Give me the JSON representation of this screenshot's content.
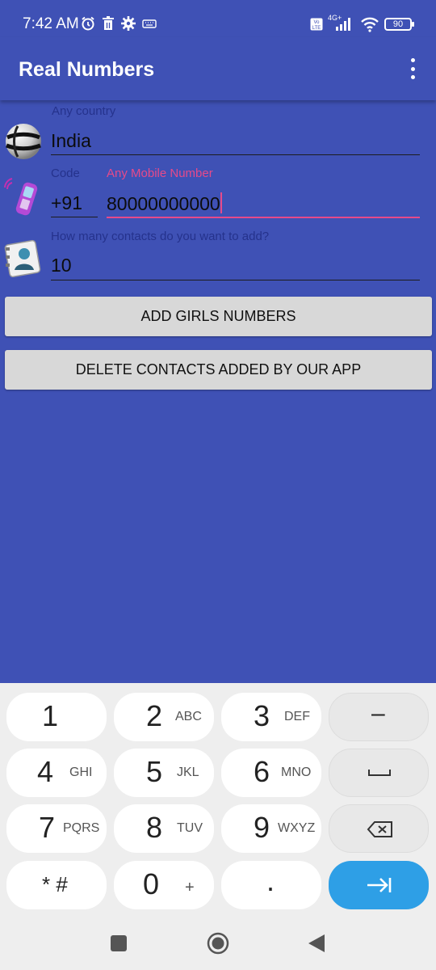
{
  "status_bar": {
    "time": "7:42 AM",
    "battery": "90",
    "network": "4G+"
  },
  "app_bar": {
    "title": "Real Numbers"
  },
  "form": {
    "country_label": "Any country",
    "country_value": "India",
    "code_label": "Code",
    "code_value": "+91",
    "mobile_label": "Any Mobile Number",
    "mobile_value": "80000000000",
    "count_label": "How many contacts do you want to add?",
    "count_value": "10"
  },
  "buttons": {
    "add_label": "ADD GIRLS NUMBERS",
    "delete_label": "DELETE CONTACTS ADDED BY OUR APP"
  },
  "keyboard": {
    "rows": [
      [
        {
          "num": "1",
          "sub": ""
        },
        {
          "num": "2",
          "sub": "ABC"
        },
        {
          "num": "3",
          "sub": "DEF"
        },
        {
          "num": "–",
          "sub": ""
        }
      ],
      [
        {
          "num": "4",
          "sub": "GHI"
        },
        {
          "num": "5",
          "sub": "JKL"
        },
        {
          "num": "6",
          "sub": "MNO"
        },
        {
          "num": "",
          "sub": ""
        }
      ],
      [
        {
          "num": "7",
          "sub": "PQRS"
        },
        {
          "num": "8",
          "sub": "TUV"
        },
        {
          "num": "9",
          "sub": "WXYZ"
        },
        {
          "num": "",
          "sub": ""
        }
      ],
      [
        {
          "num": "* #",
          "sub": ""
        },
        {
          "num": "0",
          "sub": "+"
        },
        {
          "num": ".",
          "sub": ""
        },
        {
          "num": "",
          "sub": ""
        }
      ]
    ]
  },
  "icons": {
    "globe": "globe-icon",
    "phone": "mobile-phone-icon",
    "contacts": "contact-card-icon",
    "backspace": "backspace-icon",
    "space": "space-bar-icon",
    "next": "tab-next-icon"
  },
  "colors": {
    "primary": "#3f51b5",
    "accent": "#e64a8a",
    "key_go": "#2e9fe6"
  }
}
